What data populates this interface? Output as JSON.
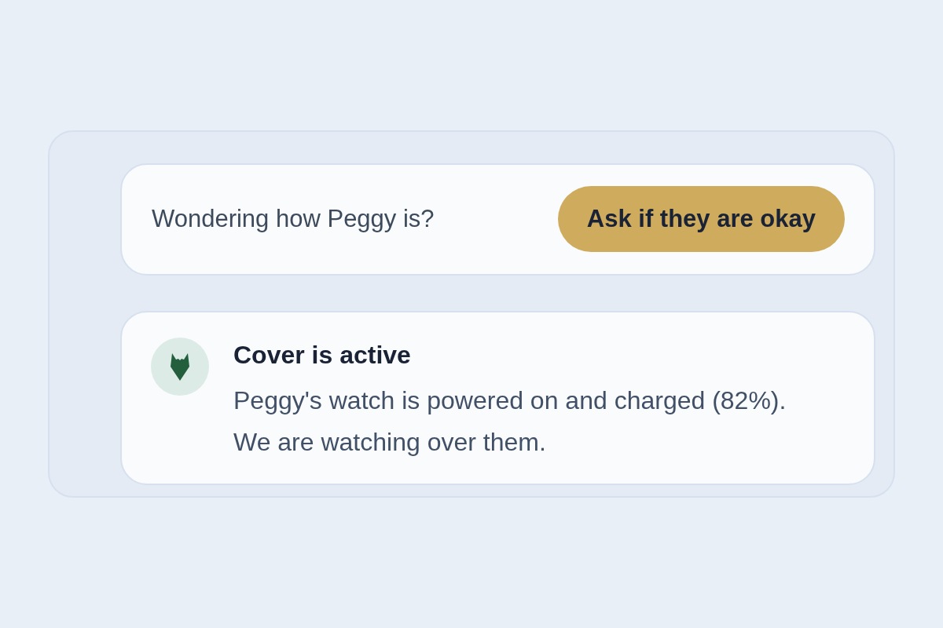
{
  "prompt": {
    "text": "Wondering how Peggy is?",
    "button": "Ask if they are okay"
  },
  "status": {
    "title": "Cover is active",
    "message": "Peggy's watch is powered on and charged (82%). We are watching over them."
  }
}
